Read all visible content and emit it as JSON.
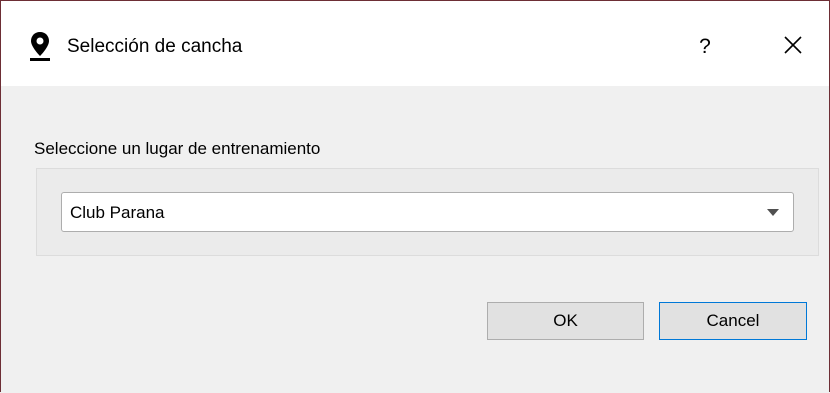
{
  "window": {
    "title": "Selección de cancha",
    "help_label": "?",
    "close_icon": "close-icon",
    "title_icon": "map-pin-icon"
  },
  "form": {
    "prompt": "Seleccione un lugar de entrenamiento",
    "select": {
      "selected_value": "Club Parana"
    }
  },
  "buttons": {
    "ok_label": "OK",
    "cancel_label": "Cancel"
  },
  "colors": {
    "window_border": "#6d2e35",
    "titlebar_bg": "#ffffff",
    "client_bg": "#f0f0f0",
    "focus_border": "#0078d7"
  }
}
